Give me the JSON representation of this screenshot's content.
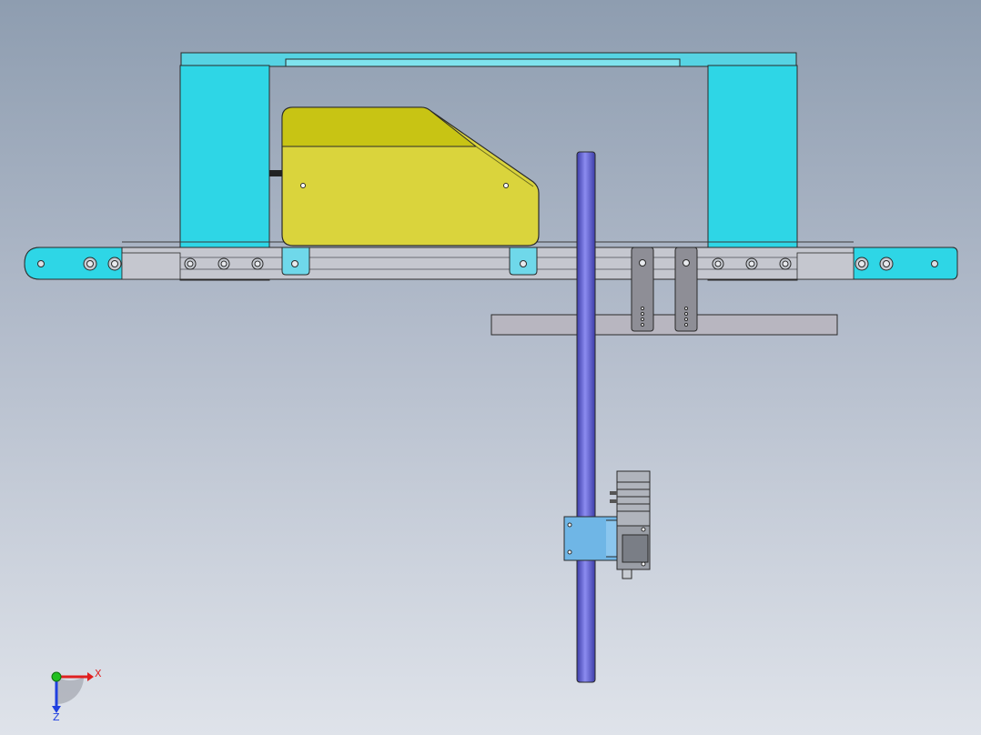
{
  "viewport": {
    "background_top": "#8e9db0",
    "background_bottom": "#dfe3ea"
  },
  "colors": {
    "frame_cyan": "#2ed6e6",
    "top_bar_cyan": "#56d3e3",
    "rail_gray": "#c5c7cf",
    "cover_yellow": "#dad43c",
    "cover_yellow_dark": "#c8c414",
    "rod_blue": "#6f6fe0",
    "plate_gray": "#b8b6c0",
    "clip_gray": "#8e8e96",
    "mount_blue": "#6fb6e6",
    "motor_gray": "#9a9ea6",
    "axis_x": "#e02020",
    "axis_y": "#20c020",
    "axis_z": "#2040e0"
  },
  "triad": {
    "x_label": "X",
    "z_label": "Z",
    "icon": "coordinate-triad-icon"
  }
}
